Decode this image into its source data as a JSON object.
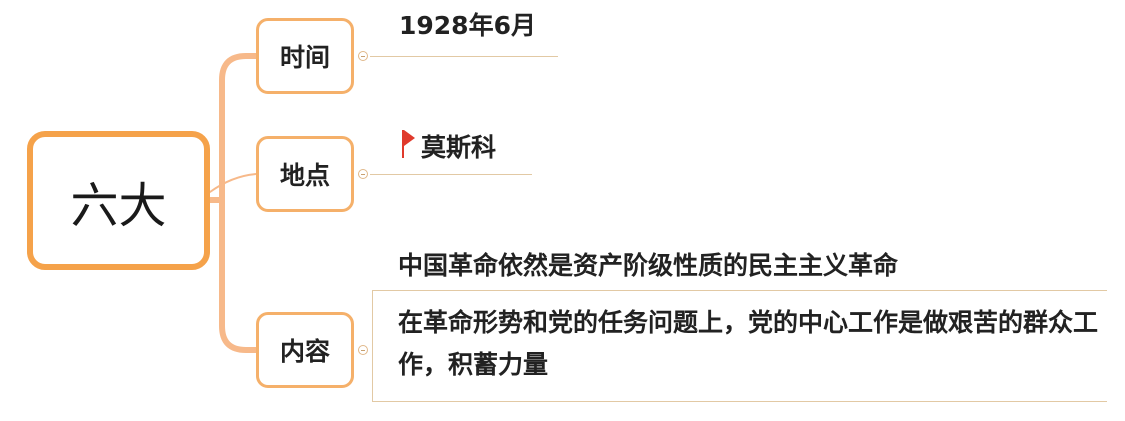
{
  "colors": {
    "accent": "#f5a24a",
    "connector": "#f7b98a",
    "leaf_underline": "#e2c9a4",
    "flag": "#e03a2c"
  },
  "root": {
    "label": "六大"
  },
  "branches": [
    {
      "label": "时间",
      "leaves": [
        "1928年6月"
      ]
    },
    {
      "label": "地点",
      "leaves": [
        "莫斯科"
      ],
      "icon": "flag-icon"
    },
    {
      "label": "内容",
      "leaves": [
        "中国革命依然是资产阶级性质的民主主义革命",
        "在革命形势和党的任务问题上，党的中心工作是做艰苦的群众工作，积蓄力量"
      ]
    }
  ]
}
